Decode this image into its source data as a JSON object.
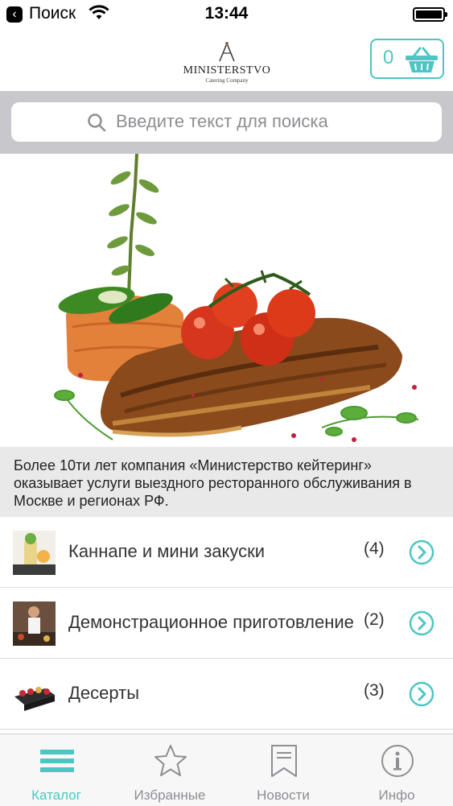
{
  "status_bar": {
    "back_label": "Поиск",
    "time": "13:44"
  },
  "header": {
    "logo_name": "MINISTERSTVO",
    "logo_subtitle": "Catering Company",
    "cart_count": "0"
  },
  "search": {
    "placeholder": "Введите текст для поиска"
  },
  "banner": {
    "description": "Более 10ти лет компания «Министерство кейтеринг» оказывает услуги выездного ресторанного обслуживания в Москве и регионах РФ."
  },
  "categories": [
    {
      "label": "Каннапе и мини закуски",
      "count": "(4)"
    },
    {
      "label": "Демонстрационное приготовление",
      "count": "(2)"
    },
    {
      "label": "Десерты",
      "count": "(3)"
    }
  ],
  "tabs": [
    {
      "label": "Каталог",
      "icon": "menu-icon",
      "active": true
    },
    {
      "label": "Избранные",
      "icon": "star-icon",
      "active": false
    },
    {
      "label": "Новости",
      "icon": "bookmark-icon",
      "active": false
    },
    {
      "label": "Инфо",
      "icon": "info-icon",
      "active": false
    }
  ],
  "colors": {
    "accent": "#4cc6c3",
    "search_bg": "#c8c8cc",
    "description_bg": "#e9e9ea"
  }
}
